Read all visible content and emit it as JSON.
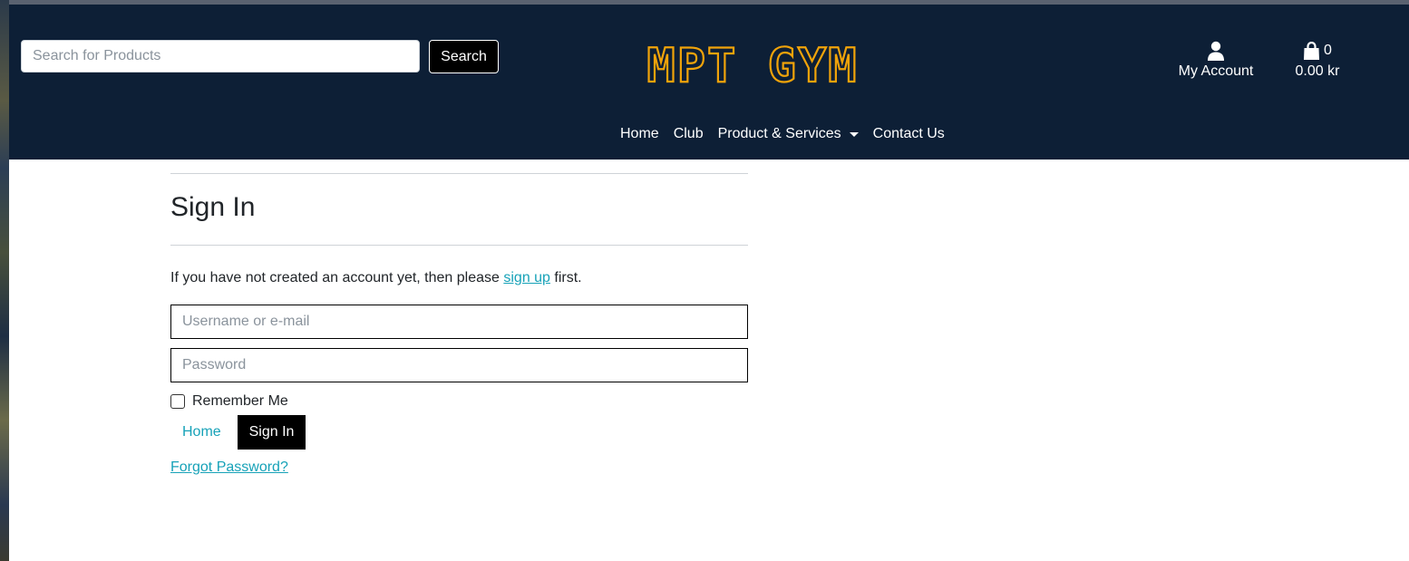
{
  "header": {
    "search": {
      "placeholder": "Search for Products",
      "button_label": "Search"
    },
    "logo_text": "MPT GYM",
    "account_label": "My Account",
    "bag": {
      "count": "0",
      "total": "0.00 kr"
    }
  },
  "nav": {
    "items": [
      {
        "label": "Home"
      },
      {
        "label": "Club"
      },
      {
        "label": "Product & Services"
      },
      {
        "label": "Contact Us"
      }
    ]
  },
  "main": {
    "title": "Sign In",
    "intro": {
      "before": "If you have not created an account yet, then please ",
      "link": "sign up",
      "after": " first."
    },
    "username_placeholder": "Username or e-mail",
    "password_placeholder": "Password",
    "remember_label": "Remember Me",
    "home_label": "Home",
    "signin_label": "Sign In",
    "forgot_label": "Forgot Password?"
  },
  "colors": {
    "header_bg": "#0d1f36",
    "logo": "#f0a30a",
    "link": "#17a2b8",
    "button_bg": "#000000"
  },
  "icons": {
    "account": "user-icon",
    "bag": "shopping-bag-icon",
    "dropdown": "caret-down-icon"
  }
}
